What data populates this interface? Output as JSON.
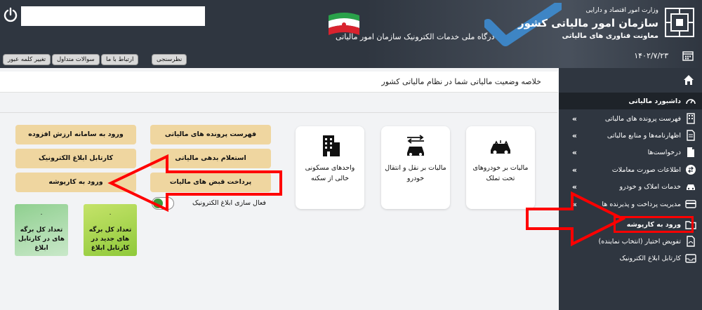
{
  "header": {
    "org_line1": "وزارت امور اقتصاد و دارایی",
    "org_line2": "سازمان امور مالیاتی کشور",
    "org_line3": "معاونت فناوری های مالیاتی",
    "portal_title": "درگاه ملی خدمات الکترونیک سازمان امور مالیاتی",
    "date": "۱۴۰۲/۷/۲۳",
    "buttons": {
      "change_password": "تغییر کلمه عبور",
      "faq": "سوالات متداول",
      "contact": "ارتباط با ما",
      "survey": "نظرسنجی"
    }
  },
  "sidebar": {
    "items": [
      {
        "label": "داشبورد مالیاتی",
        "icon": "speedometer-icon",
        "has_chevron": false,
        "active": true
      },
      {
        "label": "فهرست پرونده های مالیاتی",
        "icon": "building-icon",
        "has_chevron": true,
        "active": false
      },
      {
        "label": "اظهارنامه‌ها و منابع مالیاتی",
        "icon": "document-icon",
        "has_chevron": true,
        "active": false
      },
      {
        "label": "درخواست‌ها",
        "icon": "file-request-icon",
        "has_chevron": true,
        "active": false
      },
      {
        "label": "اطلاعات صورت معاملات",
        "icon": "exchange-icon",
        "has_chevron": true,
        "active": false
      },
      {
        "label": "خدمات املاک و خودرو",
        "icon": "car-icon",
        "has_chevron": true,
        "active": false
      },
      {
        "label": "مدیریت پرداخت و پذیرنده ها",
        "icon": "credit-card-icon",
        "has_chevron": true,
        "active": false
      },
      {
        "label": "ورود به کارپوشه",
        "icon": "folder-icon",
        "has_chevron": false,
        "active": false
      },
      {
        "label": "تفویض اختیار (انتخاب نماینده)",
        "icon": "delegate-icon",
        "has_chevron": false,
        "active": false
      },
      {
        "label": "کارتابل ابلاغ الکترونیک",
        "icon": "inbox-icon",
        "has_chevron": false,
        "active": false
      }
    ]
  },
  "main": {
    "page_title": "خلاصه وضعیت مالیاتی شما در نظام مالیاتی کشور",
    "cards": [
      {
        "label": "مالیات بر خودروهای تحت تملک",
        "icon": "car-crash-icon"
      },
      {
        "label": "مالیات بر نقل و انتقال خودرو",
        "icon": "car-transfer-icon"
      },
      {
        "label": "واحدهای مسکونی خالی از سکنه",
        "icon": "apartment-icon"
      }
    ],
    "buttons": {
      "tax_files": "فهرست پرونده های مالیاتی",
      "debt_inquiry": "استعلام بدهی مالیاتی",
      "tax_payment": "پرداخت قبض های مالیات",
      "vat_login": "ورود به سامانه ارزش افزوده",
      "e_notice": "کارتابل ابلاغ الکترونیک",
      "workspace": "ورود به کارپوشه"
    },
    "toggle_label": "فعال سازی ابلاغ الکترونیک",
    "toggle_on": true,
    "stats": [
      {
        "value": "۰",
        "label": "تعداد کل برگه های جدید در کارتابل ابلاغ",
        "color": "#a9d74a"
      },
      {
        "value": "۰",
        "label": "تعداد کل برگه های در کارتابل ابلاغ",
        "color": "#9ad3a0"
      }
    ]
  },
  "colors": {
    "header_bg": "#2f3640",
    "sidebar_bg": "#2f3640",
    "button_tan": "#efd6a0",
    "highlight_red": "#ff0000"
  }
}
